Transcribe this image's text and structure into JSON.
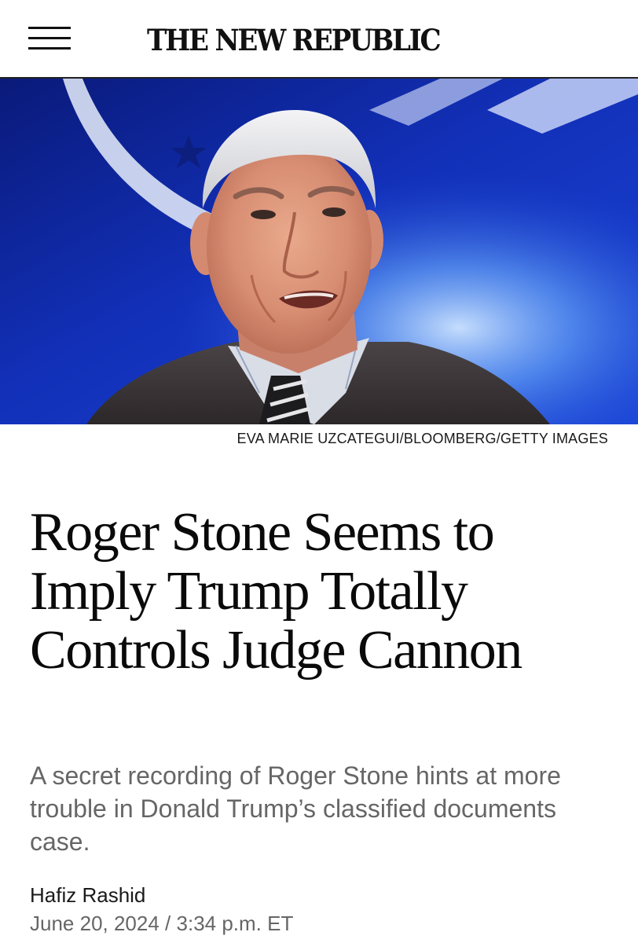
{
  "header": {
    "logo_text": "THE NEW REPUBLIC",
    "menu_icon": "hamburger-menu-icon"
  },
  "hero": {
    "photo_credit": "EVA MARIE UZCATEGUI/BLOOMBERG/GETTY IMAGES"
  },
  "article": {
    "headline": "Roger Stone Seems to Imply Trump Totally Controls Judge Cannon",
    "dek": "A secret recording of Roger Stone hints at more trouble in Donald Trump’s classified documents case.",
    "author": "Hafiz Rashid",
    "date": "June 20, 2024",
    "separator": "/",
    "time": "3:34 p.m. ET"
  },
  "colors": {
    "hero_background": "#0b1f8e",
    "text_primary": "#0a0a0a",
    "text_secondary": "#666666"
  }
}
